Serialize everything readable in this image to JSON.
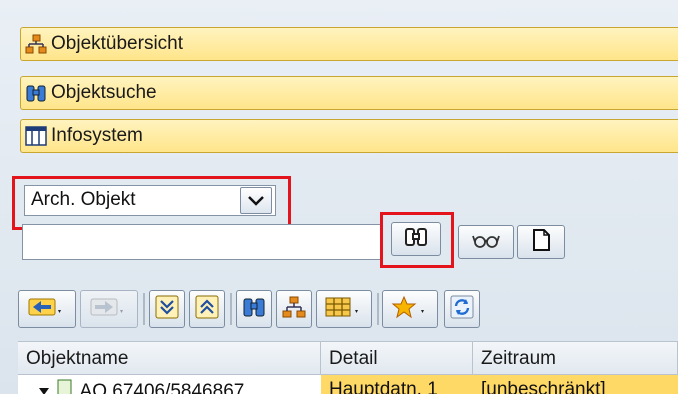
{
  "panels": [
    {
      "label": "Objektübersicht",
      "icon": "hierarchy-icon"
    },
    {
      "label": "Objektsuche",
      "icon": "binoculars-icon"
    },
    {
      "label": "Infosystem",
      "icon": "table-icon"
    }
  ],
  "search": {
    "type_select_value": "Arch. Objekt",
    "input_value": ""
  },
  "table": {
    "columns": [
      "Objektname",
      "Detail",
      "Zeitraum"
    ],
    "rows": [
      {
        "name": "AQ 67406/5846867",
        "detail": "Hauptdatn. 1",
        "period": "[unbeschränkt]"
      }
    ]
  },
  "colors": {
    "highlight_frame": "#e3141b",
    "panel_yellow": "#ffe58a"
  }
}
